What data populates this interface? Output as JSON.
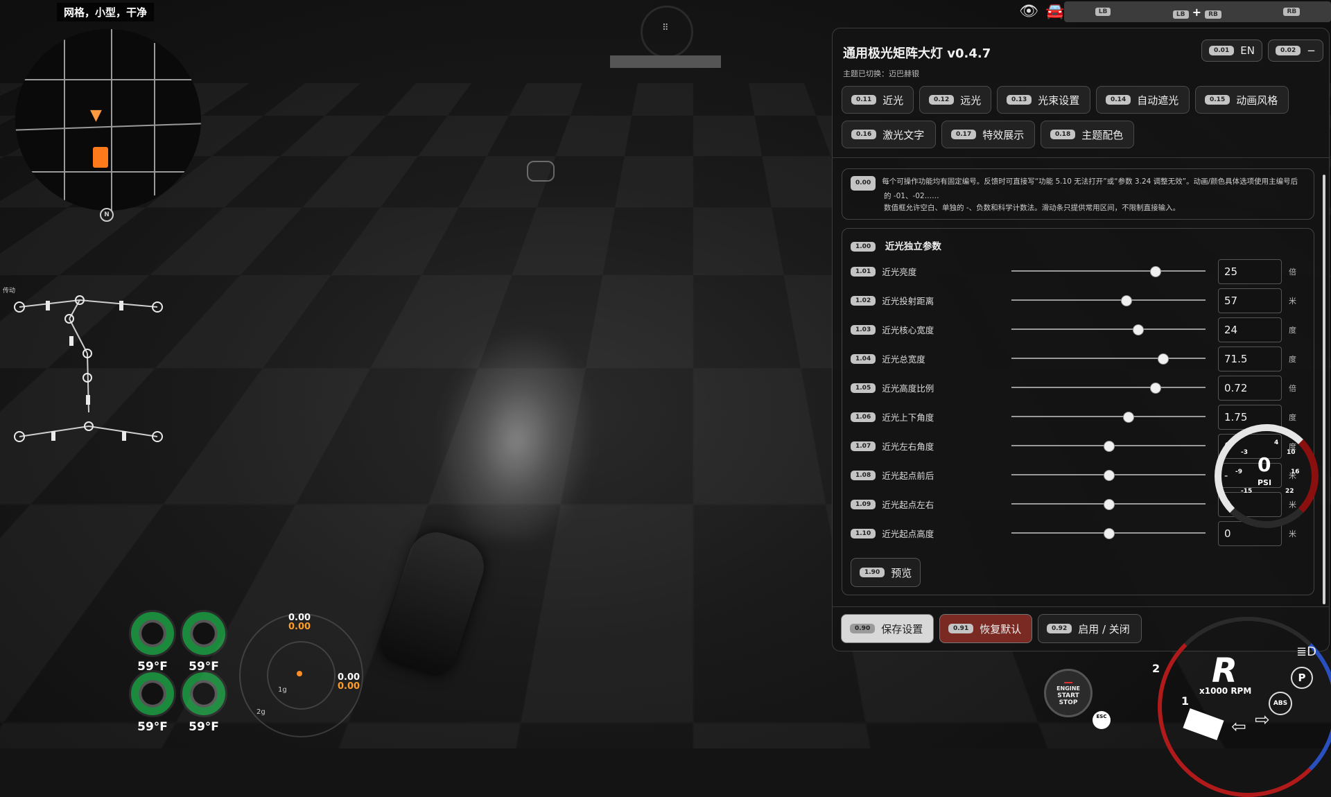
{
  "minimap": {
    "label": "网格，小型，干净",
    "north": "N"
  },
  "drivetrain": {
    "label": "传动"
  },
  "tires": [
    {
      "temp": "59°F"
    },
    {
      "temp": "59°F"
    },
    {
      "temp": "59°F"
    },
    {
      "temp": "59°F"
    }
  ],
  "gmeter": {
    "top_white": "0.00",
    "top_orange": "0.00",
    "right_white": "0.00",
    "right_orange": "0.00",
    "ring1": "1g",
    "ring2": "2g"
  },
  "top_tabs": [
    "LB",
    "LB",
    "RB",
    "RB"
  ],
  "panel": {
    "title": "通用极光矩阵大灯 v0.4.7",
    "subtitle": "主题已切换：迈巴赫银",
    "lang_btn": {
      "code": "0.01",
      "label": "EN"
    },
    "min_btn": {
      "code": "0.02",
      "label": "−"
    },
    "tabs": [
      {
        "code": "0.11",
        "label": "近光"
      },
      {
        "code": "0.12",
        "label": "远光"
      },
      {
        "code": "0.13",
        "label": "光束设置"
      },
      {
        "code": "0.14",
        "label": "自动遮光"
      },
      {
        "code": "0.15",
        "label": "动画风格"
      },
      {
        "code": "0.16",
        "label": "激光文字"
      },
      {
        "code": "0.17",
        "label": "特效展示"
      },
      {
        "code": "0.18",
        "label": "主题配色"
      }
    ],
    "info": {
      "code": "0.00",
      "line1": "每个可操作功能均有固定编号。反馈时可直接写“功能 5.10 无法打开”或“参数 3.24 调整无效”。动画/颜色具体选项使用主编号后",
      "line2": "的 -01、-02……",
      "line3": "数值框允许空白、单独的 -、负数和科学计数法。滑动条只提供常用区间，不限制直接输入。"
    },
    "section": {
      "code": "1.00",
      "title": "近光独立参数"
    },
    "params": [
      {
        "code": "1.01",
        "label": "近光亮度",
        "value": "25",
        "unit": "倍",
        "slider": 0.74
      },
      {
        "code": "1.02",
        "label": "近光投射距离",
        "value": "57",
        "unit": "米",
        "slider": 0.59
      },
      {
        "code": "1.03",
        "label": "近光核心宽度",
        "value": "24",
        "unit": "度",
        "slider": 0.65
      },
      {
        "code": "1.04",
        "label": "近光总宽度",
        "value": "71.5",
        "unit": "度",
        "slider": 0.78
      },
      {
        "code": "1.05",
        "label": "近光高度比例",
        "value": "0.72",
        "unit": "倍",
        "slider": 0.74
      },
      {
        "code": "1.06",
        "label": "近光上下角度",
        "value": "1.75",
        "unit": "度",
        "slider": 0.6
      },
      {
        "code": "1.07",
        "label": "近光左右角度",
        "value": "0",
        "unit": "度",
        "slider": 0.5
      },
      {
        "code": "1.08",
        "label": "近光起点前后",
        "value": "-",
        "unit": "米",
        "slider": 0.5
      },
      {
        "code": "1.09",
        "label": "近光起点左右",
        "value": "0",
        "unit": "米",
        "slider": 0.5
      },
      {
        "code": "1.10",
        "label": "近光起点高度",
        "value": "0",
        "unit": "米",
        "slider": 0.5
      }
    ],
    "preview": {
      "code": "1.90",
      "label": "预览"
    },
    "footer": [
      {
        "code": "0.90",
        "label": "保存设置"
      },
      {
        "code": "0.91",
        "label": "恢复默认"
      },
      {
        "code": "0.92",
        "label": "启用 / 关闭"
      }
    ]
  },
  "boost": {
    "value": "0",
    "unit": "PSI",
    "ticks": [
      "-3",
      "-9",
      "-15",
      "4",
      "10",
      "16",
      "22"
    ]
  },
  "tacho": {
    "gear": "R",
    "rpm_label": "x1000 RPM",
    "num_left": "2",
    "num_bottom": "1",
    "p_badge": "P",
    "abs_badge": "ABS"
  },
  "engine": {
    "l1": "ENGINE",
    "l2": "START",
    "l3": "STOP",
    "esc": "ESC"
  },
  "colors": {
    "accent_red": "#7a2a22",
    "save_bg": "#d8d8d8",
    "tire_green": "#1b8a3c",
    "boost_red": "#8a1010"
  }
}
